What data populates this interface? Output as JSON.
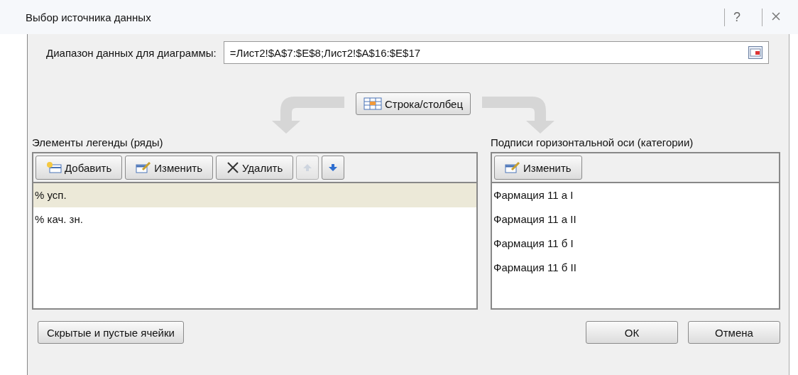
{
  "window": {
    "title": "Выбор источника данных",
    "help": "?"
  },
  "range": {
    "label": "Диапазон данных для диаграммы:",
    "value": "=Лист2!$A$7:$E$8;Лист2!$A$16:$E$17"
  },
  "switch_button": "Строка/столбец",
  "legend": {
    "title": "Элементы легенды (ряды)",
    "toolbar": [
      {
        "kind": "add",
        "label": "Добавить",
        "disabled": false
      },
      {
        "kind": "edit",
        "label": "Изменить",
        "disabled": false
      },
      {
        "kind": "remove",
        "label": "Удалить",
        "disabled": false
      },
      {
        "kind": "up",
        "disabled": true
      },
      {
        "kind": "down",
        "disabled": false
      }
    ],
    "items": [
      {
        "label": "% усп.",
        "selected": true
      },
      {
        "label": "% кач. зн.",
        "selected": false
      }
    ]
  },
  "axis": {
    "title": "Подписи горизонтальной оси (категории)",
    "toolbar": [
      {
        "kind": "edit",
        "label": "Изменить",
        "disabled": false
      }
    ],
    "items": [
      {
        "label": "Фармация 11 а I",
        "selected": false
      },
      {
        "label": "Фармация 11 а II",
        "selected": false
      },
      {
        "label": "Фармация 11 б I",
        "selected": false
      },
      {
        "label": "Фармация 11 б II",
        "selected": false
      }
    ]
  },
  "buttons": {
    "hidden_cells": "Скрытые и пустые ячейки",
    "ok": "ОК",
    "cancel": "Отмена"
  }
}
